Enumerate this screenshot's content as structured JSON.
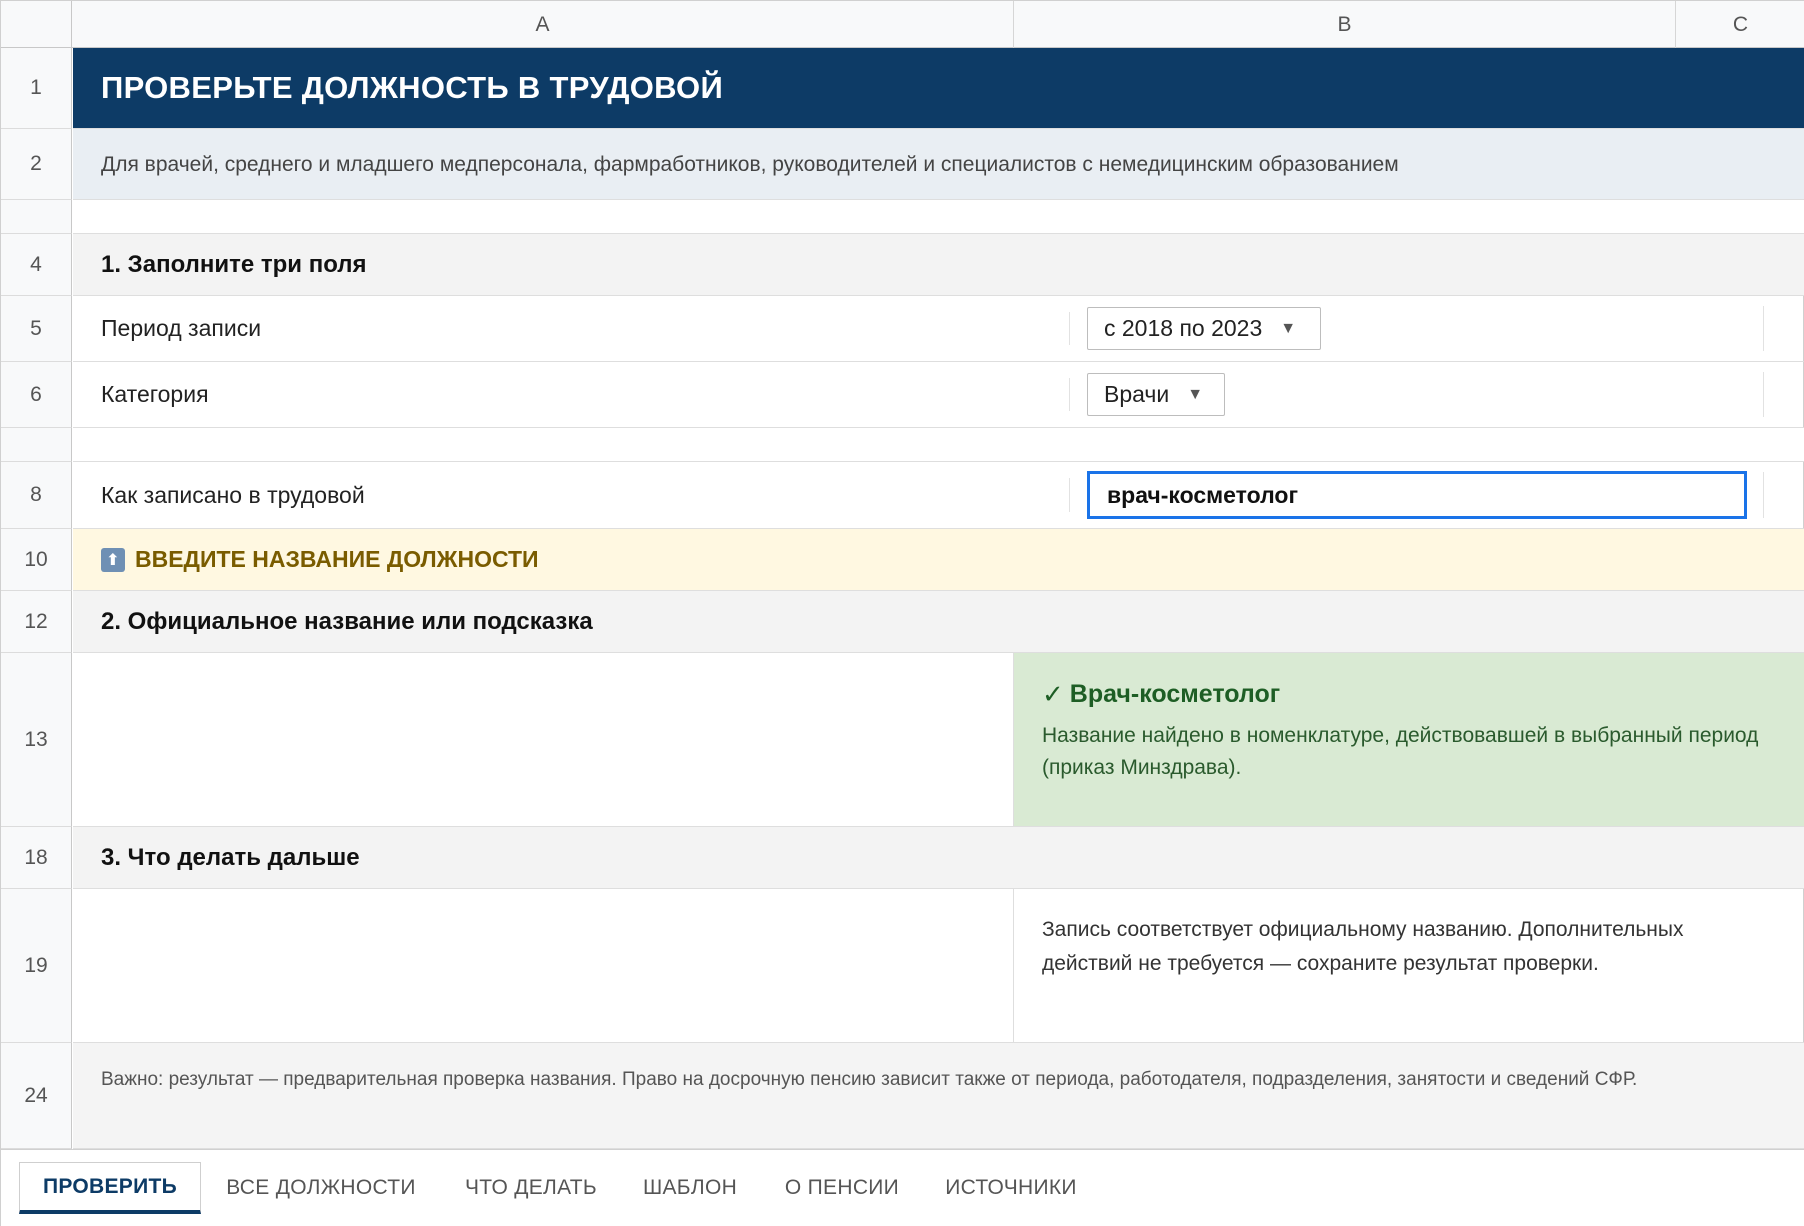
{
  "columns": [
    "A",
    "B",
    "C"
  ],
  "rows": {
    "r1": "1",
    "r2": "2",
    "r4": "4",
    "r5": "5",
    "r6": "6",
    "r8": "8",
    "r10": "10",
    "r12": "12",
    "r13": "13",
    "r18": "18",
    "r19": "19",
    "r24": "24"
  },
  "title": "ПРОВЕРЬТЕ ДОЛЖНОСТЬ В ТРУДОВОЙ",
  "subtitle": "Для врачей, среднего и младшего медперсонала, фармработников, руководителей и специалистов с немедицинским образованием",
  "section1": {
    "heading": "1. Заполните три поля",
    "period_label": "Период записи",
    "period_value": "с 2018 по 2023",
    "category_label": "Категория",
    "category_value": "Врачи",
    "record_label": "Как записано в трудовой",
    "record_value": "врач-косметолог"
  },
  "warning": {
    "icon": "up-arrow-icon",
    "text": "ВВЕДИТЕ НАЗВАНИЕ ДОЛЖНОСТИ"
  },
  "section2": {
    "heading": "2. Официальное название или подсказка",
    "result_check": "✓",
    "result_title": "Врач-косметолог",
    "result_text": "Название найдено в номенклатуре, действовавшей в выбранный период (приказ Минздрава)."
  },
  "section3": {
    "heading": "3. Что делать дальше",
    "text": "Запись соответствует официальному названию. Дополнительных действий не требуется — сохраните результат проверки."
  },
  "note": "Важно: результат — предварительная проверка названия. Право на досрочную пенсию зависит также от периода, работодателя, подразделения, занятости и сведений СФР.",
  "tabs": [
    "ПРОВЕРИТЬ",
    "ВСЕ ДОЛЖНОСТИ",
    "ЧТО ДЕЛАТЬ",
    "ШАБЛОН",
    "О ПЕНСИИ",
    "ИСТОЧНИКИ"
  ],
  "colors": {
    "title_bg": "#0d3b66",
    "result_bg": "#d9ead3",
    "warning_bg": "#fff8e1",
    "input_focus": "#1a73e8"
  }
}
